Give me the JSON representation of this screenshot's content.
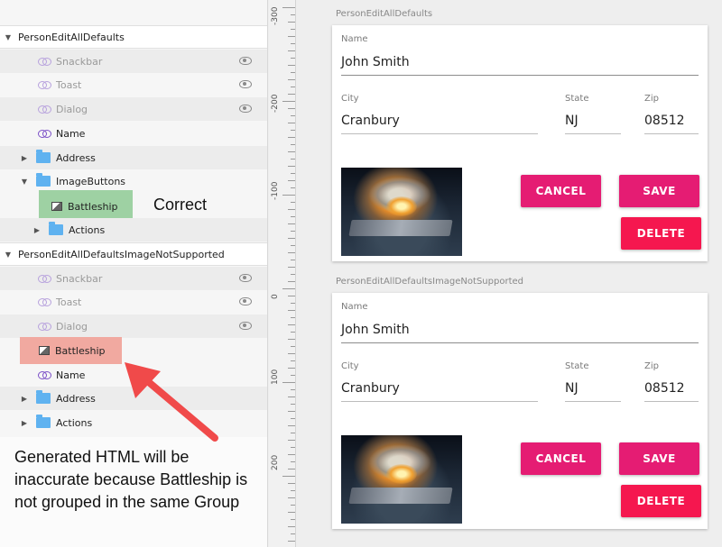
{
  "layers": {
    "group1": {
      "title": "PersonEditAllDefaults",
      "items": [
        {
          "label": "Snackbar",
          "dim": true
        },
        {
          "label": "Toast",
          "dim": true
        },
        {
          "label": "Dialog",
          "dim": true
        },
        {
          "label": "Name",
          "dim": false
        }
      ],
      "address": "Address",
      "imagebuttons": "ImageButtons",
      "battleship": "Battleship",
      "actions": "Actions",
      "correct_note": "Correct"
    },
    "group2": {
      "title": "PersonEditAllDefaultsImageNotSupported",
      "items": [
        {
          "label": "Snackbar",
          "dim": true
        },
        {
          "label": "Toast",
          "dim": true
        },
        {
          "label": "Dialog",
          "dim": true
        }
      ],
      "battleship": "Battleship",
      "name": "Name",
      "address": "Address",
      "actions": "Actions"
    },
    "callout": "Generated HTML will be inaccurate because Battleship is not grouped in the same Group"
  },
  "ruler": {
    "labels": [
      "-300",
      "-200",
      "-100",
      "0",
      "100",
      "200"
    ]
  },
  "artboards": [
    {
      "label": "PersonEditAllDefaults",
      "name_label": "Name",
      "name_value": "John Smith",
      "city_label": "City",
      "city_value": "Cranbury",
      "state_label": "State",
      "state_value": "NJ",
      "zip_label": "Zip",
      "zip_value": "08512",
      "cancel": "CANCEL",
      "save": "SAVE",
      "delete": "DELETE"
    },
    {
      "label": "PersonEditAllDefaultsImageNotSupported",
      "name_label": "Name",
      "name_value": "John Smith",
      "city_label": "City",
      "city_value": "Cranbury",
      "state_label": "State",
      "state_value": "NJ",
      "zip_label": "Zip",
      "zip_value": "08512",
      "cancel": "CANCEL",
      "save": "SAVE",
      "delete": "DELETE"
    }
  ],
  "colors": {
    "primary_button": "#e51c73",
    "delete_button": "#f5174f",
    "correct_highlight": "#9ed1a3",
    "error_highlight": "#f1a9a0",
    "arrow": "#f04a4a"
  }
}
